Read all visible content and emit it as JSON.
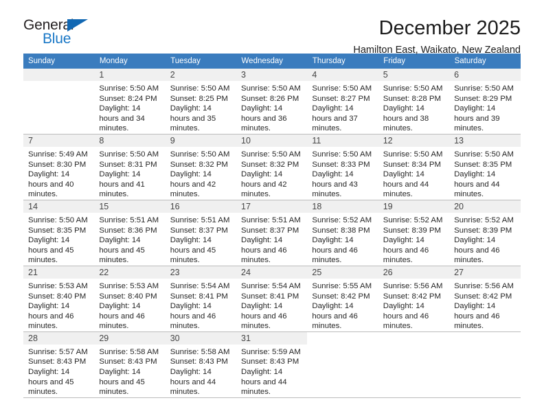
{
  "brand": {
    "word_one": "General",
    "word_two": "Blue",
    "accent_color": "#1877c6",
    "triangle_color": "#1268b3",
    "triangle_icon": "triangle-icon"
  },
  "header": {
    "title": "December 2025",
    "subtitle": "Hamilton East, Waikato, New Zealand"
  },
  "calendar": {
    "header_bg": "#3a7cbe",
    "header_text_color": "#ffffff",
    "daynum_bg": "#f0f0f0",
    "weekday_headers": [
      "Sunday",
      "Monday",
      "Tuesday",
      "Wednesday",
      "Thursday",
      "Friday",
      "Saturday"
    ],
    "weeks": [
      [
        {
          "day": "",
          "sunrise": "",
          "sunset": "",
          "daylight": "",
          "empty": true
        },
        {
          "day": "1",
          "sunrise": "Sunrise: 5:50 AM",
          "sunset": "Sunset: 8:24 PM",
          "daylight": "Daylight: 14 hours and 34 minutes."
        },
        {
          "day": "2",
          "sunrise": "Sunrise: 5:50 AM",
          "sunset": "Sunset: 8:25 PM",
          "daylight": "Daylight: 14 hours and 35 minutes."
        },
        {
          "day": "3",
          "sunrise": "Sunrise: 5:50 AM",
          "sunset": "Sunset: 8:26 PM",
          "daylight": "Daylight: 14 hours and 36 minutes."
        },
        {
          "day": "4",
          "sunrise": "Sunrise: 5:50 AM",
          "sunset": "Sunset: 8:27 PM",
          "daylight": "Daylight: 14 hours and 37 minutes."
        },
        {
          "day": "5",
          "sunrise": "Sunrise: 5:50 AM",
          "sunset": "Sunset: 8:28 PM",
          "daylight": "Daylight: 14 hours and 38 minutes."
        },
        {
          "day": "6",
          "sunrise": "Sunrise: 5:50 AM",
          "sunset": "Sunset: 8:29 PM",
          "daylight": "Daylight: 14 hours and 39 minutes."
        }
      ],
      [
        {
          "day": "7",
          "sunrise": "Sunrise: 5:49 AM",
          "sunset": "Sunset: 8:30 PM",
          "daylight": "Daylight: 14 hours and 40 minutes."
        },
        {
          "day": "8",
          "sunrise": "Sunrise: 5:50 AM",
          "sunset": "Sunset: 8:31 PM",
          "daylight": "Daylight: 14 hours and 41 minutes."
        },
        {
          "day": "9",
          "sunrise": "Sunrise: 5:50 AM",
          "sunset": "Sunset: 8:32 PM",
          "daylight": "Daylight: 14 hours and 42 minutes."
        },
        {
          "day": "10",
          "sunrise": "Sunrise: 5:50 AM",
          "sunset": "Sunset: 8:32 PM",
          "daylight": "Daylight: 14 hours and 42 minutes."
        },
        {
          "day": "11",
          "sunrise": "Sunrise: 5:50 AM",
          "sunset": "Sunset: 8:33 PM",
          "daylight": "Daylight: 14 hours and 43 minutes."
        },
        {
          "day": "12",
          "sunrise": "Sunrise: 5:50 AM",
          "sunset": "Sunset: 8:34 PM",
          "daylight": "Daylight: 14 hours and 44 minutes."
        },
        {
          "day": "13",
          "sunrise": "Sunrise: 5:50 AM",
          "sunset": "Sunset: 8:35 PM",
          "daylight": "Daylight: 14 hours and 44 minutes."
        }
      ],
      [
        {
          "day": "14",
          "sunrise": "Sunrise: 5:50 AM",
          "sunset": "Sunset: 8:35 PM",
          "daylight": "Daylight: 14 hours and 45 minutes."
        },
        {
          "day": "15",
          "sunrise": "Sunrise: 5:51 AM",
          "sunset": "Sunset: 8:36 PM",
          "daylight": "Daylight: 14 hours and 45 minutes."
        },
        {
          "day": "16",
          "sunrise": "Sunrise: 5:51 AM",
          "sunset": "Sunset: 8:37 PM",
          "daylight": "Daylight: 14 hours and 45 minutes."
        },
        {
          "day": "17",
          "sunrise": "Sunrise: 5:51 AM",
          "sunset": "Sunset: 8:37 PM",
          "daylight": "Daylight: 14 hours and 46 minutes."
        },
        {
          "day": "18",
          "sunrise": "Sunrise: 5:52 AM",
          "sunset": "Sunset: 8:38 PM",
          "daylight": "Daylight: 14 hours and 46 minutes."
        },
        {
          "day": "19",
          "sunrise": "Sunrise: 5:52 AM",
          "sunset": "Sunset: 8:39 PM",
          "daylight": "Daylight: 14 hours and 46 minutes."
        },
        {
          "day": "20",
          "sunrise": "Sunrise: 5:52 AM",
          "sunset": "Sunset: 8:39 PM",
          "daylight": "Daylight: 14 hours and 46 minutes."
        }
      ],
      [
        {
          "day": "21",
          "sunrise": "Sunrise: 5:53 AM",
          "sunset": "Sunset: 8:40 PM",
          "daylight": "Daylight: 14 hours and 46 minutes."
        },
        {
          "day": "22",
          "sunrise": "Sunrise: 5:53 AM",
          "sunset": "Sunset: 8:40 PM",
          "daylight": "Daylight: 14 hours and 46 minutes."
        },
        {
          "day": "23",
          "sunrise": "Sunrise: 5:54 AM",
          "sunset": "Sunset: 8:41 PM",
          "daylight": "Daylight: 14 hours and 46 minutes."
        },
        {
          "day": "24",
          "sunrise": "Sunrise: 5:54 AM",
          "sunset": "Sunset: 8:41 PM",
          "daylight": "Daylight: 14 hours and 46 minutes."
        },
        {
          "day": "25",
          "sunrise": "Sunrise: 5:55 AM",
          "sunset": "Sunset: 8:42 PM",
          "daylight": "Daylight: 14 hours and 46 minutes."
        },
        {
          "day": "26",
          "sunrise": "Sunrise: 5:56 AM",
          "sunset": "Sunset: 8:42 PM",
          "daylight": "Daylight: 14 hours and 46 minutes."
        },
        {
          "day": "27",
          "sunrise": "Sunrise: 5:56 AM",
          "sunset": "Sunset: 8:42 PM",
          "daylight": "Daylight: 14 hours and 46 minutes."
        }
      ],
      [
        {
          "day": "28",
          "sunrise": "Sunrise: 5:57 AM",
          "sunset": "Sunset: 8:43 PM",
          "daylight": "Daylight: 14 hours and 45 minutes."
        },
        {
          "day": "29",
          "sunrise": "Sunrise: 5:58 AM",
          "sunset": "Sunset: 8:43 PM",
          "daylight": "Daylight: 14 hours and 45 minutes."
        },
        {
          "day": "30",
          "sunrise": "Sunrise: 5:58 AM",
          "sunset": "Sunset: 8:43 PM",
          "daylight": "Daylight: 14 hours and 44 minutes."
        },
        {
          "day": "31",
          "sunrise": "Sunrise: 5:59 AM",
          "sunset": "Sunset: 8:43 PM",
          "daylight": "Daylight: 14 hours and 44 minutes."
        },
        {
          "day": "",
          "sunrise": "",
          "sunset": "",
          "daylight": "",
          "blank": true
        },
        {
          "day": "",
          "sunrise": "",
          "sunset": "",
          "daylight": "",
          "blank": true
        },
        {
          "day": "",
          "sunrise": "",
          "sunset": "",
          "daylight": "",
          "blank": true
        }
      ]
    ]
  }
}
